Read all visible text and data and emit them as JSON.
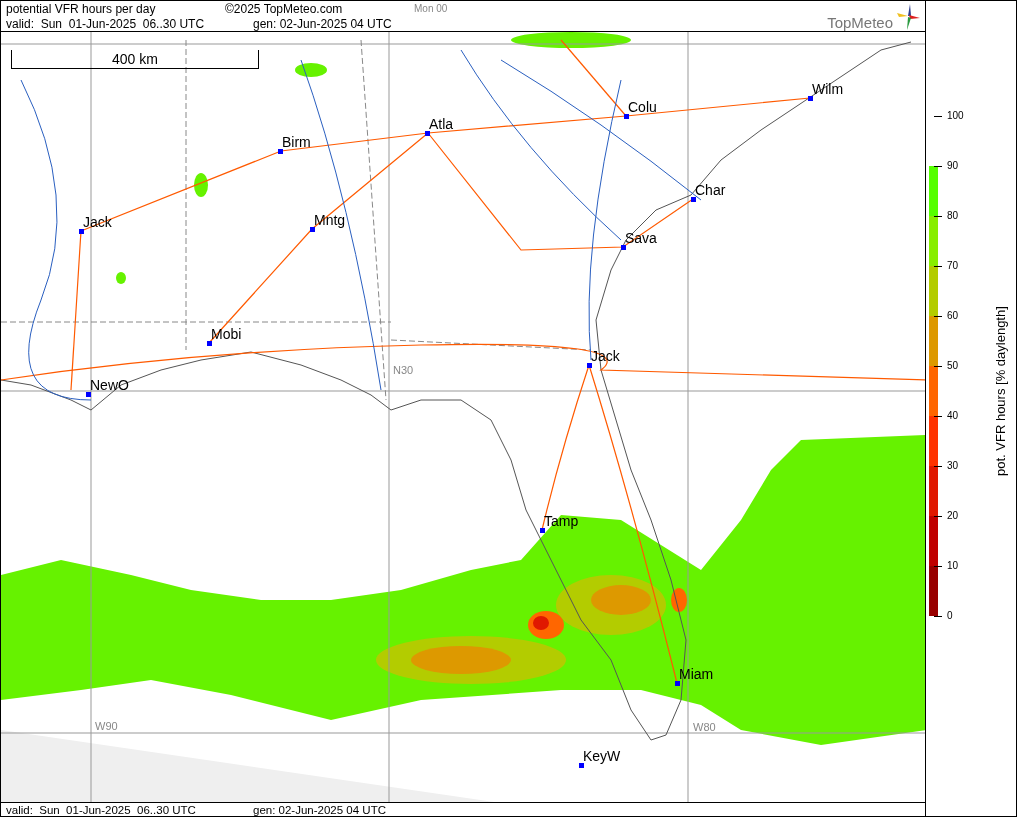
{
  "header": {
    "title": "potential VFR hours per day",
    "copyright": "©2025 TopMeteo.com",
    "run": "Mon 00",
    "valid": "valid:  Sun  01-Jun-2025  06..30 UTC",
    "generated": "gen: 02-Jun-2025 04 UTC",
    "logo": "TopMeteo"
  },
  "map": {
    "scale": "400 km",
    "cities": [
      {
        "name": "Wilm"
      },
      {
        "name": "Colu"
      },
      {
        "name": "Atla"
      },
      {
        "name": "Birm"
      },
      {
        "name": "Char"
      },
      {
        "name": "Jack"
      },
      {
        "name": "Mntg"
      },
      {
        "name": "Sava"
      },
      {
        "name": "Mobi"
      },
      {
        "name": "Jack"
      },
      {
        "name": "NewO"
      },
      {
        "name": "Tamp"
      },
      {
        "name": "Miam"
      },
      {
        "name": "KeyW"
      }
    ],
    "grid_labels": [
      "N30",
      "W90",
      "W80"
    ]
  },
  "colorbar": {
    "title": "pot. VFR hours [% daylength]",
    "ticks": [
      "100",
      "90",
      "80",
      "70",
      "60",
      "50",
      "40",
      "30",
      "20",
      "10",
      "0"
    ],
    "bands": [
      {
        "color": "#55ff00"
      },
      {
        "color": "#88ee00"
      },
      {
        "color": "#b3cc00"
      },
      {
        "color": "#dd9900"
      },
      {
        "color": "#ff6600"
      },
      {
        "color": "#ff3300"
      },
      {
        "color": "#e01800"
      },
      {
        "color": "#c00000"
      },
      {
        "color": "#990000"
      }
    ]
  },
  "footer": {
    "valid": "valid:  Sun  01-Jun-2025  06..30 UTC",
    "generated": "gen: 02-Jun-2025 04 UTC"
  }
}
